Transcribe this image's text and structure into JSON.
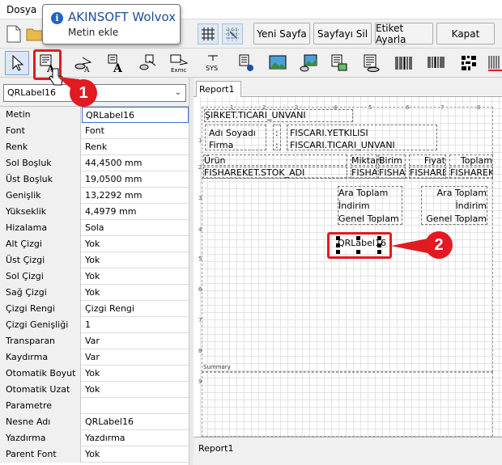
{
  "menu": {
    "file": "Dosya"
  },
  "tooltip": {
    "title": "AKINSOFT Wolvox",
    "subtitle": "Metin ekle"
  },
  "toolbar": {
    "new_page": "Yeni Sayfa",
    "delete_page": "Sayfayı Sil",
    "label_settings": "Etiket Ayarla",
    "close": "Kapat"
  },
  "tools": [
    "pointer-tool",
    "qrlabel-tool",
    "dbtext-tool",
    "expr-tool",
    "expr-db-tool",
    "sysdata-tool",
    "richtext-tool",
    "image-tool",
    "dbimage-tool",
    "shape-tool",
    "memo-tool",
    "barcode-tool",
    "db-barcode-tool",
    "matrix-barcode-tool"
  ],
  "tool_labels": {
    "sys": "SYS",
    "exmc": "Exmc"
  },
  "component_select": {
    "value": "QRLabel16"
  },
  "properties": [
    {
      "name": "Metin",
      "value": "QRLabel16"
    },
    {
      "name": "Font",
      "value": "Font"
    },
    {
      "name": "Renk",
      "value": "Renk"
    },
    {
      "name": "Sol Boşluk",
      "value": "44,4500 mm"
    },
    {
      "name": "Üst Boşluk",
      "value": "19,0500 mm"
    },
    {
      "name": "Genişlik",
      "value": "13,2292 mm"
    },
    {
      "name": "Yükseklik",
      "value": "4,4979 mm"
    },
    {
      "name": "Hizalama",
      "value": "Sola"
    },
    {
      "name": "Alt Çizgi",
      "value": "Yok"
    },
    {
      "name": "Üst Çizgi",
      "value": "Yok"
    },
    {
      "name": "Sol Çizgi",
      "value": "Yok"
    },
    {
      "name": "Sağ Çizgi",
      "value": "Yok"
    },
    {
      "name": "Çizgi Rengi",
      "value": "Çizgi Rengi"
    },
    {
      "name": "Çizgi Genişliği",
      "value": "1"
    },
    {
      "name": "Transparan",
      "value": "Var"
    },
    {
      "name": "Kaydırma",
      "value": "Var"
    },
    {
      "name": "Otomatik Boyut",
      "value": "Yok"
    },
    {
      "name": "Otomatik Uzat",
      "value": "Yok"
    },
    {
      "name": "Parametre",
      "value": ""
    },
    {
      "name": "Nesne Adı",
      "value": "QRLabel16"
    },
    {
      "name": "Yazdırma",
      "value": "Yazdırma"
    },
    {
      "name": "Parent Font",
      "value": "Yok"
    }
  ],
  "report": {
    "tab": "Report1",
    "company": "ŞIRKET.TICARI_UNVANI",
    "name_label": "Adı Soyadı",
    "firm_label": "Firma",
    "colon": ":",
    "authorized": "FISCARI.YETKILISI",
    "company_field": "FISCARI.TICARI_UNVANI",
    "col_product": "Ürün",
    "col_qty": "Miktarı",
    "col_unit": "Birim",
    "col_price": "Fiyat",
    "col_total": "Toplam",
    "f_stock": "FISHAREKET.STOK_ADI",
    "f_qty": "FISHA",
    "f_unit": "FISHA",
    "f_price": "FISHARE",
    "f_total": "FISHAREK",
    "sub_total": "Ara Toplam",
    "discount": "İndirim",
    "grand_total": "Genel Toplam",
    "selected_label": "QRLabel16",
    "summary_band": "Summary",
    "ruler_v": [
      "1",
      "2",
      "3",
      "4",
      "5",
      "6",
      "7",
      "8",
      "9"
    ],
    "ruler_h": [
      "1",
      "2",
      "3",
      "4",
      "5",
      "6",
      "7",
      "8"
    ]
  },
  "annotations": {
    "step1": "1",
    "step2": "2"
  },
  "colors": {
    "accent_red": "#e21a22",
    "tooltip_title": "#1a4f9c"
  }
}
